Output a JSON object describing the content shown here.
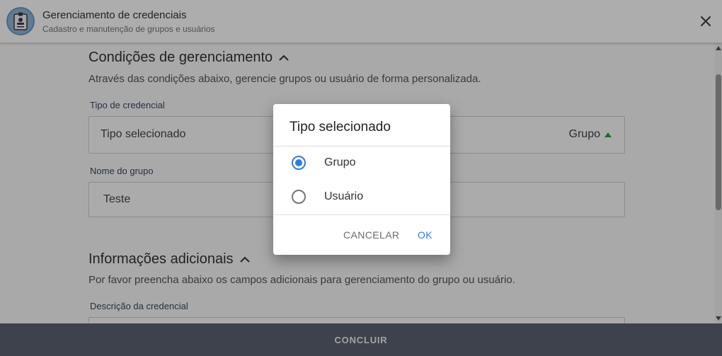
{
  "header": {
    "title": "Gerenciamento de credenciais",
    "subtitle": "Cadastro e manutenção de grupos e usuários",
    "avatar_icon": "id-badge-icon",
    "close_icon": "close-icon"
  },
  "main": {
    "section1": {
      "title": "Condições de gerenciamento",
      "description": "Através das condições abaixo, gerencie grupos ou usuário de forma personalizada."
    },
    "credential_type": {
      "label": "Tipo de credencial",
      "placeholder": "Tipo selecionado",
      "value": "Grupo"
    },
    "group_name": {
      "label": "Nome do grupo",
      "value": "Teste"
    },
    "section2": {
      "title": "Informações adicionais",
      "description": "Por favor preencha abaixo os campos adicionais para gerenciamento do grupo ou usuário."
    },
    "credential_description": {
      "label": "Descrição da credencial"
    }
  },
  "footer": {
    "button_label": "CONCLUIR"
  },
  "dialog": {
    "title": "Tipo selecionado",
    "options": [
      {
        "label": "Grupo",
        "selected": true
      },
      {
        "label": "Usuário",
        "selected": false
      }
    ],
    "cancel_label": "CANCELAR",
    "ok_label": "OK"
  },
  "colors": {
    "accent": "#2f7de1",
    "footer": "#5a6270",
    "select_arrow": "#2e9e4a"
  }
}
